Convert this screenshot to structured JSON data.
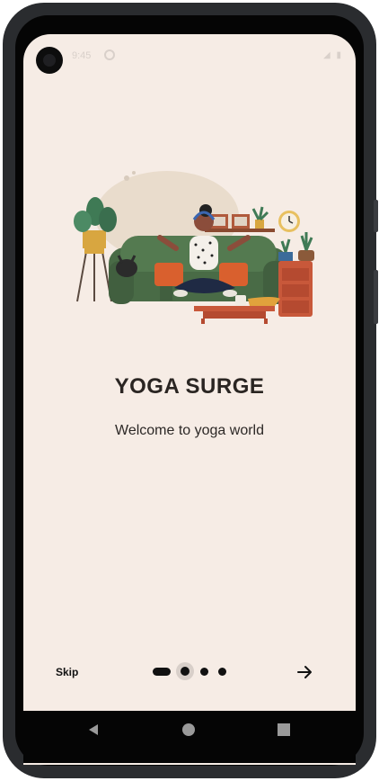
{
  "status_bar": {
    "time": "9:45"
  },
  "onboarding": {
    "title": "YOGA SURGE",
    "subtitle": "Welcome to yoga world",
    "skip_label": "Skip",
    "page_count": 4,
    "active_page": 1,
    "next_icon": "arrow-right-icon"
  },
  "navigation": {
    "back_icon": "back-triangle-icon",
    "home_icon": "home-circle-icon",
    "recents_icon": "recents-square-icon"
  },
  "colors": {
    "background": "#f6ece5",
    "text": "#2a2522",
    "accent": "#111111"
  }
}
